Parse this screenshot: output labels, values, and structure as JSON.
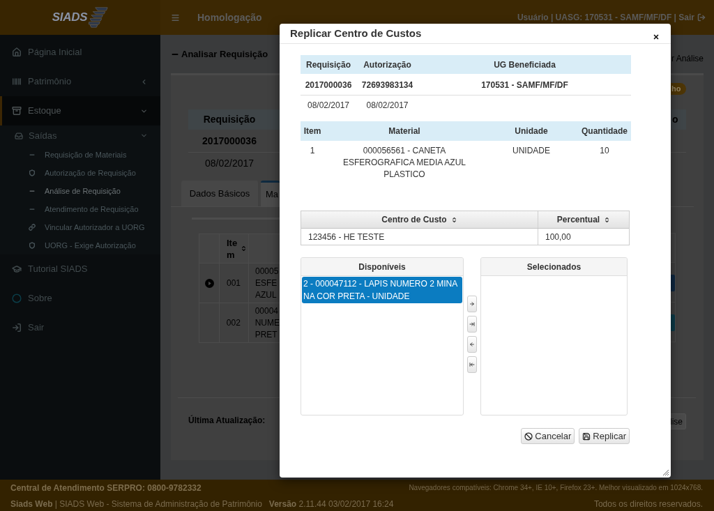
{
  "header": {
    "logo": "SIADS",
    "environment": "Homologação",
    "user_info": "Usuário | UASG: 170531 - SAMF/MF/DF | Sair"
  },
  "sidebar": {
    "items": [
      {
        "label": "Página Inicial",
        "selected": false
      },
      {
        "label": "Patrimônio",
        "selected": false,
        "expanded": false
      },
      {
        "label": "Estoque",
        "selected": true,
        "expanded": true,
        "children": [
          {
            "label": "Saídas",
            "expanded": true,
            "children": [
              {
                "label": "Requisição de Materiais",
                "selected": false
              },
              {
                "label": "Autorização de Requisição",
                "selected": false
              },
              {
                "label": "Análise de Requisição",
                "selected": true
              },
              {
                "label": "Atendimento de Requisição",
                "selected": false
              },
              {
                "label": "Vincular Autorizador a UORG",
                "selected": false
              },
              {
                "label": "UORG - Exige Autorização",
                "selected": false
              }
            ]
          }
        ]
      },
      {
        "label": "Tutorial SIADS",
        "selected": false
      },
      {
        "label": "Sobre",
        "selected": false
      },
      {
        "label": "Sair",
        "selected": false
      }
    ]
  },
  "page": {
    "title": "Analisar Requisição",
    "breadcrumb": "r Análise",
    "badge": "ho",
    "summary": {
      "columns": [
        "Requisição",
        "o"
      ],
      "number": "2017000036",
      "date": "08/02/2017"
    },
    "tabs": [
      {
        "label": "Dados Básicos",
        "selected": false
      },
      {
        "label": "Ma",
        "selected": true
      }
    ],
    "items_table": {
      "columns": [
        "Item"
      ],
      "rows": [
        {
          "expander": true,
          "item": "001",
          "material": [
            "00005",
            "ESFE",
            "AZUL"
          ],
          "color": "#0e2740"
        },
        {
          "expander": false,
          "item": "002",
          "material": [
            "00004",
            "NUME",
            "PRET"
          ],
          "color": "#0b3a48"
        }
      ]
    },
    "last_update": "Última Atualização:",
    "button": "lise"
  },
  "dialog": {
    "title": "Replicar Centro de Custos",
    "request_table": {
      "columns": [
        "Requisição",
        "Autorização",
        "UG Beneficiada"
      ],
      "rows": [
        {
          "kind": "number",
          "cells": [
            "2017000036",
            "72693983134",
            "170531 - SAMF/MF/DF"
          ]
        },
        {
          "kind": "date",
          "cells": [
            "08/02/2017",
            "08/02/2017"
          ]
        }
      ]
    },
    "material_table": {
      "columns": [
        "Item",
        "Material",
        "Unidade",
        "Quantidade"
      ],
      "rows": [
        [
          "1",
          "000056561 - CANETA ESFEROGRAFICA MEDIA AZUL PLASTICO",
          "UNIDADE",
          "10"
        ]
      ]
    },
    "cost_center_table": {
      "columns": [
        "Centro de Custo",
        "Percentual"
      ],
      "rows": [
        [
          "123456 - HE TESTE",
          "100,00"
        ]
      ]
    },
    "picklist": {
      "source": {
        "title": "Disponíveis",
        "items": [
          {
            "label": "2 - 000047112 - LAPIS NUMERO 2 MINA NA COR PRETA - UNIDADE",
            "selected": true
          }
        ]
      },
      "target": {
        "title": "Selecionados"
      }
    },
    "buttons": [
      "Cancelar",
      "Replicar"
    ]
  },
  "footer": {
    "support": "Central de Atendimento SERPRO: 0800-9782332",
    "browsers": "Navegadores compatíveis: Chrome 34+, IE 10+, Firefox 23+. Melhor visualizado em 1024x768.",
    "system": "**Siads Web** | SIADS Web - Sistema de Administração de Patrimônio   **Versão** 2.11.44 03/02/2017 16:24",
    "rights": "Todos os direitos reservados."
  }
}
